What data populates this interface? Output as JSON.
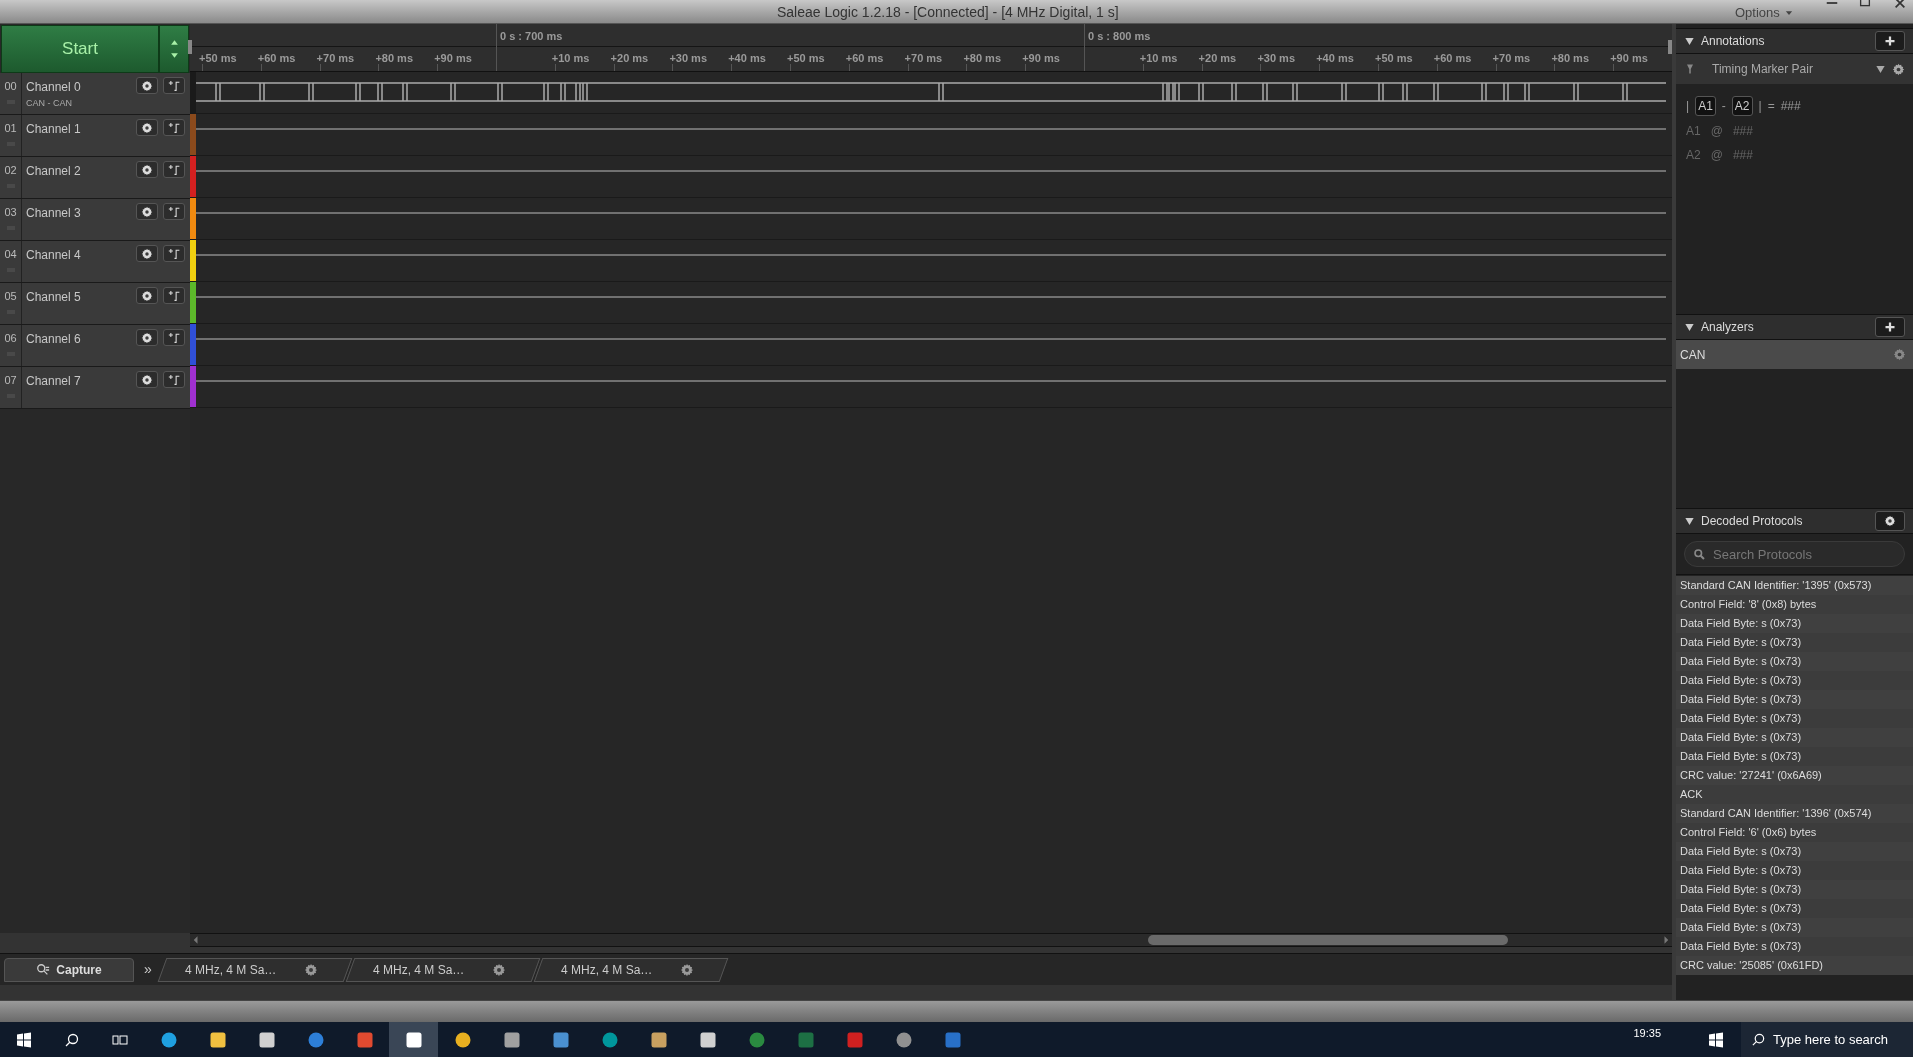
{
  "window": {
    "title": "Saleae Logic 1.2.18 - [Connected] - [4 MHz Digital, 1 s]",
    "options": "Options"
  },
  "start_button": {
    "label": "Start"
  },
  "channels": [
    {
      "number": "00",
      "name": "Channel 0",
      "analyzer": "CAN - CAN",
      "color": "#1a1a1a"
    },
    {
      "number": "01",
      "name": "Channel 1",
      "color": "#8b4a1c"
    },
    {
      "number": "02",
      "name": "Channel 2",
      "color": "#d42020"
    },
    {
      "number": "03",
      "name": "Channel 3",
      "color": "#f08a10"
    },
    {
      "number": "04",
      "name": "Channel 4",
      "color": "#f0d010"
    },
    {
      "number": "05",
      "name": "Channel 5",
      "color": "#5cb82a"
    },
    {
      "number": "06",
      "name": "Channel 6",
      "color": "#3050d8"
    },
    {
      "number": "07",
      "name": "Channel 7",
      "color": "#a030d0"
    }
  ],
  "ruler": [
    {
      "label": "+50 ms",
      "kind": "minor"
    },
    {
      "label": "+60 ms",
      "kind": "minor"
    },
    {
      "label": "+70 ms",
      "kind": "minor"
    },
    {
      "label": "+80 ms",
      "kind": "minor"
    },
    {
      "label": "+90 ms",
      "kind": "minor"
    },
    {
      "label": "0 s : 700 ms",
      "kind": "major"
    },
    {
      "label": "+10 ms",
      "kind": "minor"
    },
    {
      "label": "+20 ms",
      "kind": "minor"
    },
    {
      "label": "+30 ms",
      "kind": "minor"
    },
    {
      "label": "+40 ms",
      "kind": "minor"
    },
    {
      "label": "+50 ms",
      "kind": "minor"
    },
    {
      "label": "+60 ms",
      "kind": "minor"
    },
    {
      "label": "+70 ms",
      "kind": "minor"
    },
    {
      "label": "+80 ms",
      "kind": "minor"
    },
    {
      "label": "+90 ms",
      "kind": "minor"
    },
    {
      "label": "0 s : 800 ms",
      "kind": "major"
    },
    {
      "label": "+10 ms",
      "kind": "minor"
    },
    {
      "label": "+20 ms",
      "kind": "minor"
    },
    {
      "label": "+30 ms",
      "kind": "minor"
    },
    {
      "label": "+40 ms",
      "kind": "minor"
    },
    {
      "label": "+50 ms",
      "kind": "minor"
    },
    {
      "label": "+60 ms",
      "kind": "minor"
    },
    {
      "label": "+70 ms",
      "kind": "minor"
    },
    {
      "label": "+80 ms",
      "kind": "minor"
    },
    {
      "label": "+90 ms",
      "kind": "minor"
    }
  ],
  "annotations": {
    "title": "Annotations",
    "marker_type": "Timing Marker Pair",
    "measurement": {
      "open": "|",
      "a": "A1",
      "dash": "-",
      "b": "A2",
      "close": "|",
      "equals": "=",
      "value": "###"
    },
    "markers": [
      {
        "name": "A1",
        "at": "@",
        "value": "###"
      },
      {
        "name": "A2",
        "at": "@",
        "value": "###"
      }
    ]
  },
  "analyzers": {
    "title": "Analyzers",
    "items": [
      {
        "label": "CAN"
      }
    ]
  },
  "decoded_protocols": {
    "title": "Decoded Protocols",
    "search": {
      "placeholder": "Search Protocols"
    },
    "rows": [
      "Standard CAN Identifier: '1395' (0x573)",
      "Control Field: '8' (0x8) bytes",
      "Data Field Byte: s (0x73)",
      "Data Field Byte: s (0x73)",
      "Data Field Byte: s (0x73)",
      "Data Field Byte: s (0x73)",
      "Data Field Byte: s (0x73)",
      "Data Field Byte: s (0x73)",
      "Data Field Byte: s (0x73)",
      "Data Field Byte: s (0x73)",
      "CRC value: '27241' (0x6A69)",
      "ACK",
      "Standard CAN Identifier: '1396' (0x574)",
      "Control Field: '6' (0x6) bytes",
      "Data Field Byte: s (0x73)",
      "Data Field Byte: s (0x73)",
      "Data Field Byte: s (0x73)",
      "Data Field Byte: s (0x73)",
      "Data Field Byte: s (0x73)",
      "Data Field Byte: s (0x73)",
      "CRC value: '25085' (0x61FD)"
    ]
  },
  "bottom_tabs": {
    "capture": {
      "label": "Capture",
      "selected": true
    },
    "more": "»",
    "tabs": [
      {
        "label": "4 MHz, 4 M Sa…",
        "selected": false
      },
      {
        "label": "4 MHz, 4 M Sa…",
        "selected": false
      },
      {
        "label": "4 MHz, 4 M Sa…",
        "selected": false
      }
    ]
  },
  "taskbar": {
    "time": "19:35",
    "search": {
      "placeholder": "Type here to search"
    }
  }
}
